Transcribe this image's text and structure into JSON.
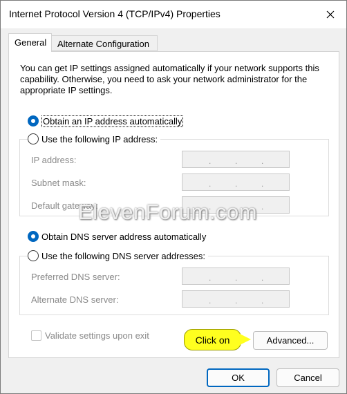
{
  "window": {
    "title": "Internet Protocol Version 4 (TCP/IPv4) Properties"
  },
  "tabs": [
    {
      "label": "General",
      "active": true
    },
    {
      "label": "Alternate Configuration",
      "active": false
    }
  ],
  "general": {
    "description": "You can get IP settings assigned automatically if your network supports this capability. Otherwise, you need to ask your network administrator for the appropriate IP settings.",
    "ip_auto_label": "Obtain an IP address automatically",
    "ip_manual_label": "Use the following IP address:",
    "ip_fields": [
      {
        "label": "IP address:",
        "value": ".    .    ."
      },
      {
        "label": "Subnet mask:",
        "value": ".    .    ."
      },
      {
        "label": "Default gateway:",
        "value": ".    .    ."
      }
    ],
    "dns_auto_label": "Obtain DNS server address automatically",
    "dns_manual_label": "Use the following DNS server addresses:",
    "dns_fields": [
      {
        "label": "Preferred DNS server:",
        "value": ".    .    ."
      },
      {
        "label": "Alternate DNS server:",
        "value": ".    .    ."
      }
    ],
    "validate_label": "Validate settings upon exit",
    "advanced_label": "Advanced..."
  },
  "callout": {
    "text": "Click on",
    "color": "#ffff1f"
  },
  "watermark": "ElevenForum.com",
  "footer": {
    "ok_label": "OK",
    "cancel_label": "Cancel"
  },
  "colors": {
    "accent": "#0067c0",
    "disabled_text": "#8a8a8a"
  }
}
